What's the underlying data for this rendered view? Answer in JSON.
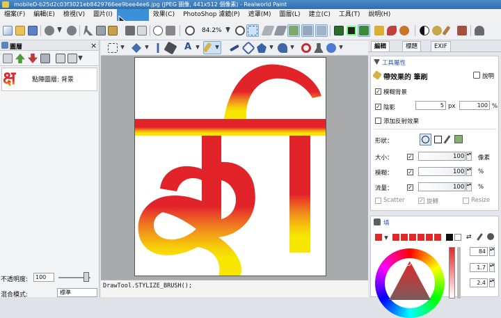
{
  "window": {
    "title": "mobileD-b25d2c03f3021eb8429766ee9bee4ee6.jpg (JPEG 圖像, 441x512 個像素) - Realworld Paint"
  },
  "menu": [
    {
      "label": "檔案(F)"
    },
    {
      "label": "編輯(E)"
    },
    {
      "label": "檢視(V)"
    },
    {
      "label": "圖片(I)"
    },
    {
      "label": "選取(S)",
      "active": true
    },
    {
      "label": "效果(C)"
    },
    {
      "label": "PhotoShop 濾鏡(P)"
    },
    {
      "label": "遮罩(M)"
    },
    {
      "label": "圖層(L)"
    },
    {
      "label": "建立(C)"
    },
    {
      "label": "工具(T)"
    },
    {
      "label": "說明(H)"
    }
  ],
  "toolbar": {
    "zoom": "84.2%"
  },
  "layers_panel": {
    "title": "圖層",
    "layer_name": "點陣圖層: 背景",
    "opacity_label": "不透明度:",
    "opacity_value": "100",
    "blend_label": "混合模式:",
    "blend_value": "標準"
  },
  "status_text": "DrawTool.STYLIZE_BRUSH();",
  "right_tabs": [
    "編輯",
    "標題",
    "EXIF"
  ],
  "tool_props": {
    "header": "工具屬性",
    "tool_name": "帶效果的 筆刷",
    "help": "說明",
    "blur_bg": "模糊背景",
    "shadow": "陰影",
    "shadow_size": "5",
    "shadow_unit": "px",
    "shadow_opacity": "100",
    "shadow_pct": "%",
    "reflection": "添加反射效果",
    "shape_label": "形狀：",
    "size_label": "大小：",
    "size_value": "100",
    "size_unit": "像素",
    "blur_label": "模糊：",
    "blur_value": "100",
    "blur_unit": "%",
    "flow_label": "流量：",
    "flow_value": "100",
    "flow_unit": "%",
    "scatter": "Scatter",
    "rotate": "旋轉",
    "resize": "Resize"
  },
  "fill_panel": {
    "header": "填",
    "value1": "84",
    "value2": "1.7",
    "value3": "2.4",
    "colors": [
      "#e02a2a",
      "#e02a2a",
      "#e02a2a",
      "#e02a2a",
      "#e02a2a",
      "#e02a2a",
      "#111111",
      "#ffffff"
    ]
  },
  "canvas_glyph": "क्ष",
  "colors": {
    "accent": "#3c90d8",
    "glyph_red": "#e2232a",
    "glyph_orange": "#f08a1d",
    "glyph_yellow": "#f6e600"
  }
}
